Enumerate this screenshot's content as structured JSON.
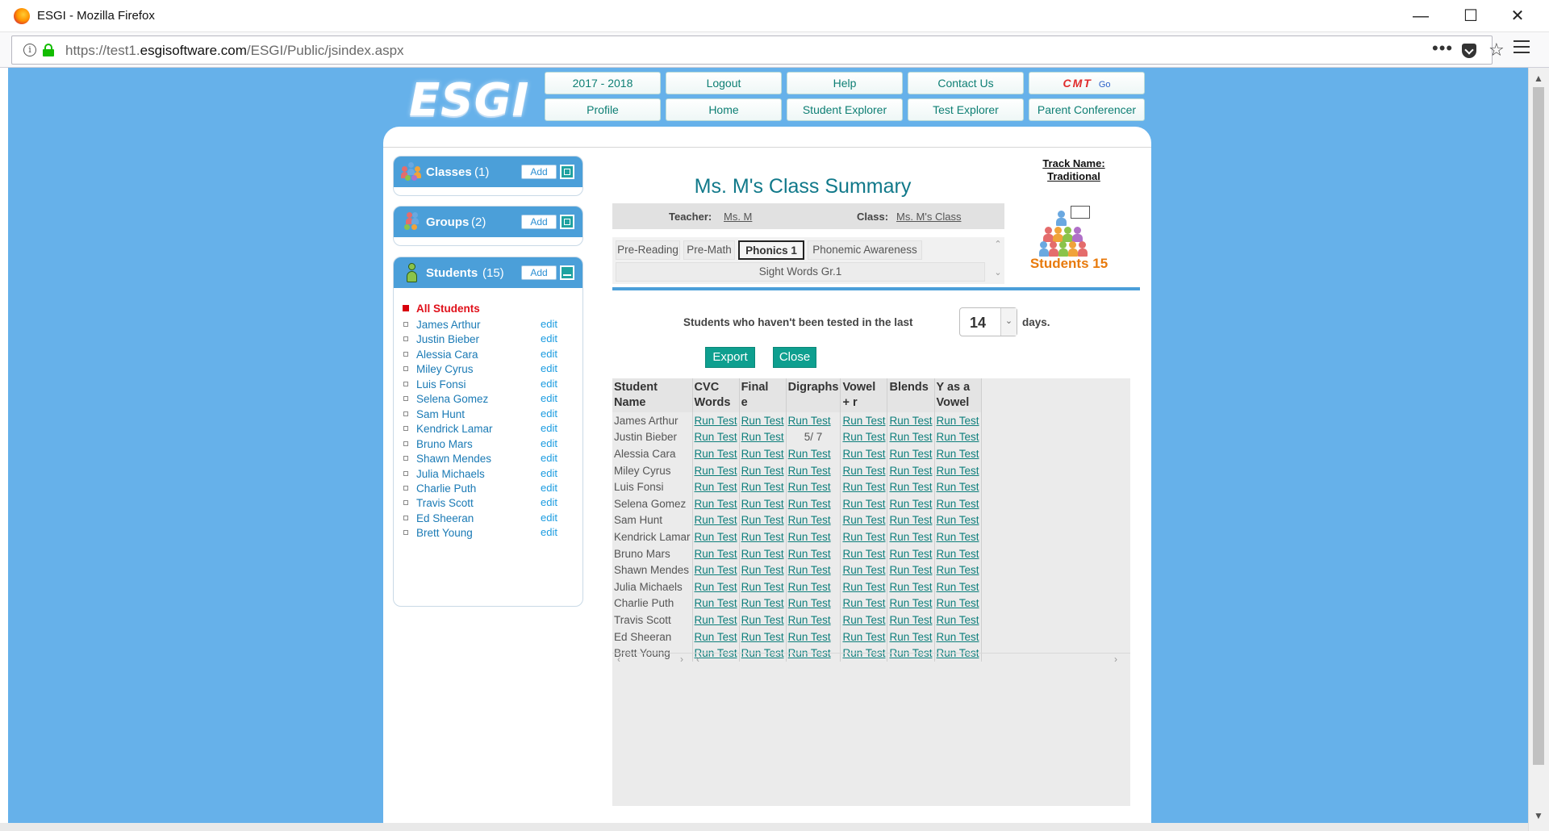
{
  "browser": {
    "window_title": "ESGI - Mozilla Firefox",
    "url_prefix": "https://test1.",
    "url_domain": "esgisoftware.com",
    "url_path": "/ESGI/Public/jsindex.aspx"
  },
  "header": {
    "logo": "ESGI",
    "nav_row1": [
      "2017 - 2018",
      "Logout",
      "Help",
      "Contact Us"
    ],
    "nav_row2": [
      "Profile",
      "Home",
      "Student Explorer",
      "Test Explorer",
      "Parent Conferencer"
    ],
    "cmt_label": "CMT",
    "cmt_go": "Go"
  },
  "sidebar": {
    "classes": {
      "label": "Classes",
      "count": "(1)",
      "add": "Add"
    },
    "groups": {
      "label": "Groups",
      "count": "(2)",
      "add": "Add"
    },
    "students": {
      "label": "Students",
      "count": "(15)",
      "add": "Add",
      "all_label": "All Students",
      "edit_label": "edit",
      "names": [
        "James Arthur",
        "Justin Bieber",
        "Alessia Cara",
        "Miley Cyrus",
        "Luis Fonsi",
        "Selena Gomez",
        "Sam Hunt",
        "Kendrick Lamar",
        "Bruno Mars",
        "Shawn Mendes",
        "Julia Michaels",
        "Charlie Puth",
        "Travis Scott",
        "Ed Sheeran",
        "Brett Young"
      ]
    }
  },
  "summary": {
    "title": "Ms. M's Class Summary",
    "track_line1": "Track Name:",
    "track_line2": "Traditional",
    "teacher_label": "Teacher:",
    "teacher_value": "Ms. M",
    "class_label": "Class:",
    "class_value": "Ms. M's Class",
    "students_count": "Students 15",
    "tabs": [
      "Pre-Reading",
      "Pre-Math",
      "Phonics 1",
      "Phonemic Awareness",
      "Sight Words Gr.1"
    ],
    "active_tab": "Phonics 1",
    "not_tested_prefix": "Students who haven't been tested in the last",
    "days_value": "14",
    "days_suffix": "days.",
    "export_label": "Export",
    "close_label": "Close"
  },
  "grid": {
    "headers": [
      [
        "Student",
        "Name"
      ],
      [
        "CVC",
        "Words"
      ],
      [
        "Final",
        "e"
      ],
      [
        "Digraphs",
        ""
      ],
      [
        "Vowel",
        "+ r"
      ],
      [
        "Blends",
        ""
      ],
      [
        "Y as a",
        "Vowel"
      ]
    ],
    "run_test": "Run Test",
    "rows": [
      [
        "James Arthur",
        "Run Test",
        "Run Test",
        "Run Test",
        "Run Test",
        "Run Test",
        "Run Test"
      ],
      [
        "Justin Bieber",
        "Run Test",
        "Run Test",
        "5/ 7",
        "Run Test",
        "Run Test",
        "Run Test"
      ],
      [
        "Alessia Cara",
        "Run Test",
        "Run Test",
        "Run Test",
        "Run Test",
        "Run Test",
        "Run Test"
      ],
      [
        "Miley Cyrus",
        "Run Test",
        "Run Test",
        "Run Test",
        "Run Test",
        "Run Test",
        "Run Test"
      ],
      [
        "Luis Fonsi",
        "Run Test",
        "Run Test",
        "Run Test",
        "Run Test",
        "Run Test",
        "Run Test"
      ],
      [
        "Selena Gomez",
        "Run Test",
        "Run Test",
        "Run Test",
        "Run Test",
        "Run Test",
        "Run Test"
      ],
      [
        "Sam Hunt",
        "Run Test",
        "Run Test",
        "Run Test",
        "Run Test",
        "Run Test",
        "Run Test"
      ],
      [
        "Kendrick Lamar",
        "Run Test",
        "Run Test",
        "Run Test",
        "Run Test",
        "Run Test",
        "Run Test"
      ],
      [
        "Bruno Mars",
        "Run Test",
        "Run Test",
        "Run Test",
        "Run Test",
        "Run Test",
        "Run Test"
      ],
      [
        "Shawn Mendes",
        "Run Test",
        "Run Test",
        "Run Test",
        "Run Test",
        "Run Test",
        "Run Test"
      ],
      [
        "Julia Michaels",
        "Run Test",
        "Run Test",
        "Run Test",
        "Run Test",
        "Run Test",
        "Run Test"
      ],
      [
        "Charlie Puth",
        "Run Test",
        "Run Test",
        "Run Test",
        "Run Test",
        "Run Test",
        "Run Test"
      ],
      [
        "Travis Scott",
        "Run Test",
        "Run Test",
        "Run Test",
        "Run Test",
        "Run Test",
        "Run Test"
      ],
      [
        "Ed Sheeran",
        "Run Test",
        "Run Test",
        "Run Test",
        "Run Test",
        "Run Test",
        "Run Test"
      ],
      [
        "Brett Young",
        "Run Test",
        "Run Test",
        "Run Test",
        "Run Test",
        "Run Test",
        "Run Test"
      ]
    ]
  },
  "colors": {
    "page_bg": "#66b1ea",
    "accent_teal": "#0e9f8f",
    "side_head": "#4b9fd9",
    "students_orange": "#e87a0c"
  }
}
